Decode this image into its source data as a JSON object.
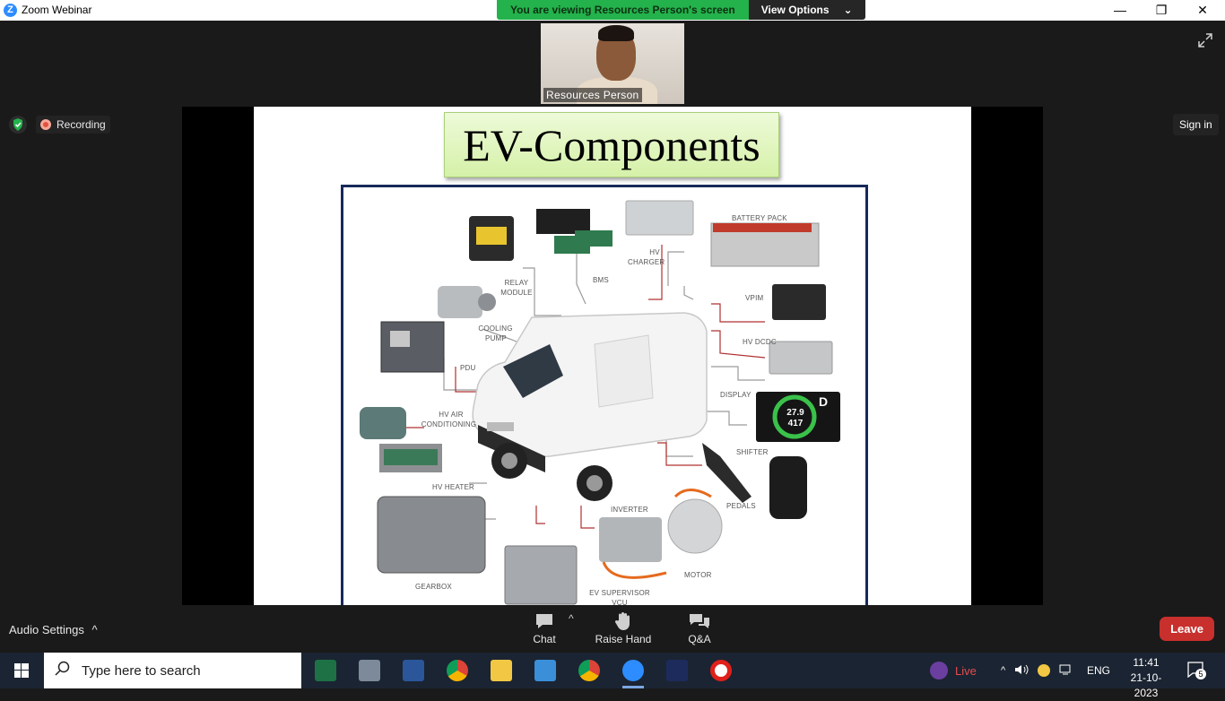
{
  "window": {
    "title": "Zoom Webinar",
    "app_icon_letter": "Z",
    "minimize": "—",
    "restore": "❐",
    "close": "✕"
  },
  "banner": {
    "message": "You are viewing Resources Person's screen",
    "view_options": "View Options",
    "chevron": "⌄"
  },
  "participant": {
    "name": "Resources Person"
  },
  "status": {
    "recording": "Recording",
    "sign_in": "Sign in"
  },
  "slide": {
    "title": "EV-Components",
    "labels": {
      "battery_pack": "BATTERY PACK",
      "hv_charger_1": "HV",
      "hv_charger_2": "CHARGER",
      "bms": "BMS",
      "relay_1": "RELAY",
      "relay_2": "MODULE",
      "cooling_1": "COOLING",
      "cooling_2": "PUMP",
      "vpim": "VPIM",
      "hv_dcdc": "HV DCDC",
      "pdu": "PDU",
      "display": "DISPLAY",
      "hv_air_1": "HV AIR",
      "hv_air_2": "CONDITIONING",
      "shifter": "SHIFTER",
      "hv_heater": "HV HEATER",
      "pedals": "PEDALS",
      "inverter": "INVERTER",
      "motor": "MOTOR",
      "gearbox": "GEARBOX",
      "vcu_1": "EV SUPERVISOR",
      "vcu_2": "VCU"
    },
    "display_values": {
      "speed": "27.9",
      "range": "417",
      "gear": "D"
    }
  },
  "controls": {
    "audio_settings": "Audio Settings",
    "caret": "^",
    "chat": "Chat",
    "raise_hand": "Raise Hand",
    "qa": "Q&A",
    "leave": "Leave"
  },
  "taskbar": {
    "search_placeholder": "Type here to search",
    "live": "Live",
    "language": "ENG",
    "time": "11:41",
    "date": "21-10-2023",
    "notification_count": "5"
  },
  "colors": {
    "zoom_blue": "#2d8cff",
    "banner_green": "#23b24b",
    "leave_red": "#c8302d",
    "slide_title_bg": "#d5f1a8",
    "figure_border": "#17295a"
  }
}
